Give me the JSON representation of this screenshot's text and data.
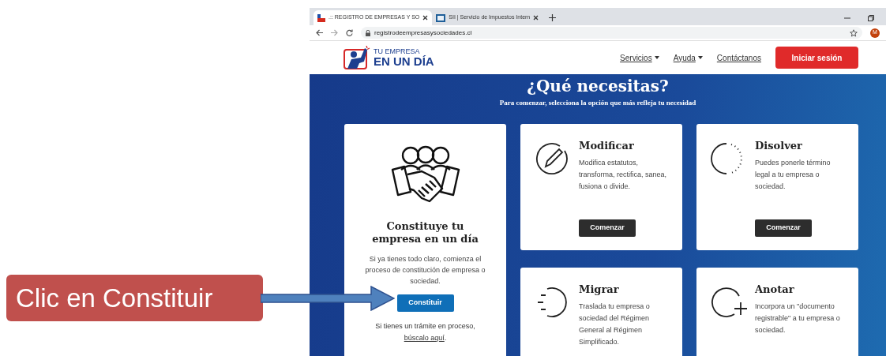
{
  "callout": {
    "text": "Clic en Constituir"
  },
  "browser": {
    "tabs": [
      {
        "title": ".:: REGISTRO DE EMPRESAS Y SO",
        "selected": true,
        "kind": "flag"
      },
      {
        "title": "SII | Servicio de Impuestos Intern",
        "selected": false,
        "kind": "sii"
      }
    ],
    "url": "registrodeempresasysociedades.cl",
    "avatar": "M"
  },
  "header": {
    "logo": {
      "line1": "TU EMPRESA",
      "line2": "EN UN DÍA"
    },
    "nav": [
      {
        "label": "Servicios",
        "dropdown": true
      },
      {
        "label": "Ayuda",
        "dropdown": true
      },
      {
        "label": "Contáctanos",
        "dropdown": false
      }
    ],
    "login": "Iniciar sesión"
  },
  "hero": {
    "title": "¿Qué necesitas?",
    "subtitle": "Para comenzar, selecciona la opción que más refleja tu necesidad"
  },
  "featured": {
    "title": "Constituye tu empresa en un día",
    "text": "Si ya tienes todo claro, comienza el proceso de constitución de empresa o sociedad.",
    "button": "Constituir",
    "footer": "Si tienes un trámite en proceso,",
    "link": "búscalo aquí",
    "end": "."
  },
  "options": [
    {
      "kind": "modify",
      "title": "Modificar",
      "text": "Modifica estatutos, transforma, rectifica, sanea, fusiona o divide.",
      "button": "Comenzar"
    },
    {
      "kind": "dissolve",
      "title": "Disolver",
      "text": "Puedes ponerle término legal a tu empresa o sociedad.",
      "button": "Comenzar"
    },
    {
      "kind": "migrate",
      "title": "Migrar",
      "text": "Traslada tu empresa o sociedad del Régimen General al Régimen Simplificado."
    },
    {
      "kind": "annotate",
      "title": "Anotar",
      "text": "Incorpora un \"documento registrable\" a tu empresa o sociedad."
    }
  ]
}
